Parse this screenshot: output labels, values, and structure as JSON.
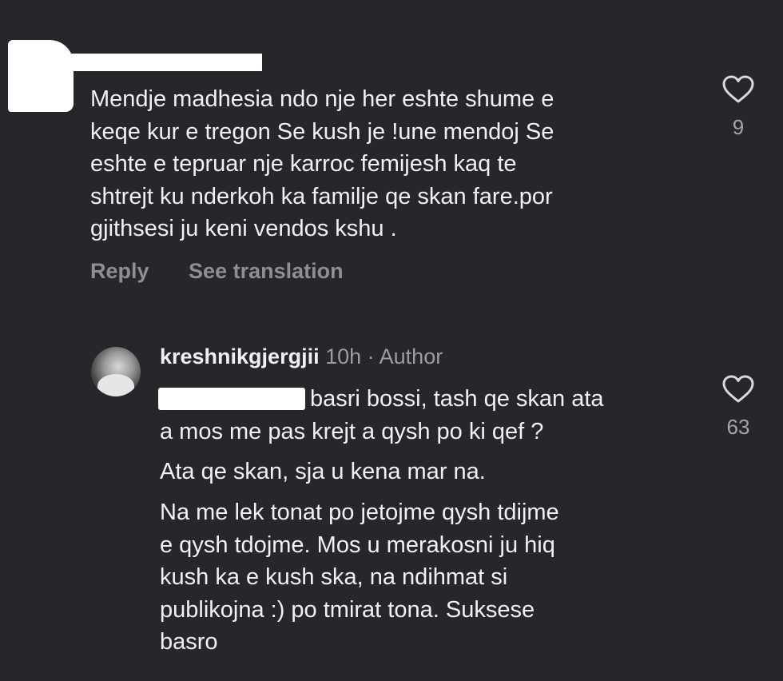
{
  "comment": {
    "lines": [
      "Mendje madhesia ndo nje her eshte shume e",
      "keqe kur e tregon Se kush je !une mendoj Se",
      "eshte e tepruar nje karroc femijesh kaq te",
      "shtrejt ku nderkoh ka familje qe skan fare.por",
      "gjithsesi ju keni vendos kshu ."
    ],
    "reply_label": "Reply",
    "translate_label": "See translation",
    "like_count": "9"
  },
  "reply": {
    "username": "kreshnikgjergjii",
    "meta": "10h · Author",
    "line1": "basri bossi, tash qe skan ata",
    "line2": "a mos me pas krejt a qysh po ki qef ?",
    "para2": "Ata qe skan, sja u kena mar na.",
    "para3": [
      "Na me lek tonat po jetojme qysh tdijme",
      "e qysh tdojme. Mos u merakosni ju hiq",
      "kush ka e kush ska, na ndihmat si",
      "publikojna :) po tmirat tona. Suksese",
      "basro"
    ],
    "like_count": "63"
  },
  "colors": {
    "background": "#25272b",
    "text": "#f1f1f1",
    "secondary": "#8d8f93"
  },
  "icons": {
    "like": "heart-outline-icon"
  }
}
